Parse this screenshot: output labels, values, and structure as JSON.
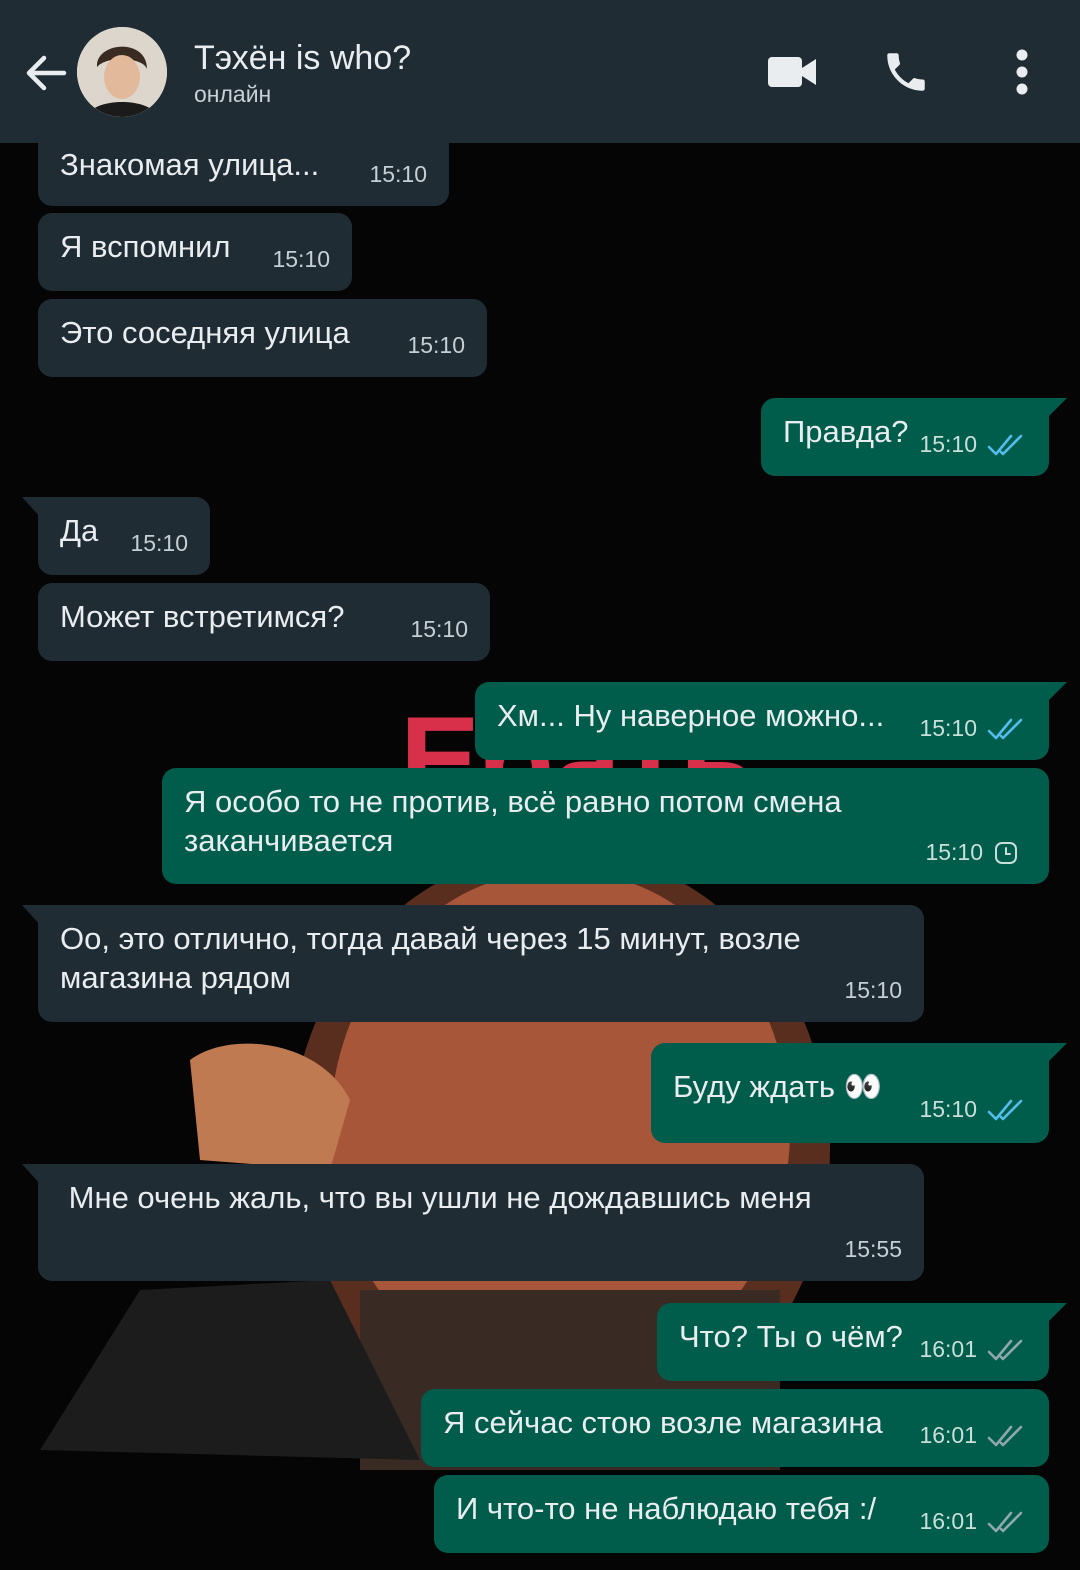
{
  "header": {
    "contact_name": "Тэхён is who?",
    "status": "онлайн",
    "back_icon": "arrow-left-icon",
    "video_icon": "video-call-icon",
    "call_icon": "phone-icon",
    "menu_icon": "more-vert-icon"
  },
  "colors": {
    "header_bg": "#1f2c34",
    "incoming_bg": "#1f2c34",
    "outgoing_bg": "#005c4b",
    "read_tick": "#53bdeb",
    "unread_tick": "#8fa7ae"
  },
  "wallpaper": {
    "caption": "Ебать"
  },
  "messages": [
    {
      "dir": "in",
      "text": "Знакомая улица...",
      "time": "15:10"
    },
    {
      "dir": "in",
      "text": "Я вспомнил",
      "time": "15:10"
    },
    {
      "dir": "in",
      "text": "Это соседняя улица",
      "time": "15:10"
    },
    {
      "dir": "out",
      "text": "Правда?",
      "time": "15:10",
      "status": "read"
    },
    {
      "dir": "in",
      "text": "Да",
      "time": "15:10"
    },
    {
      "dir": "in",
      "text": "Может встретимся?",
      "time": "15:10"
    },
    {
      "dir": "out",
      "text": "Хм... Ну наверное можно...",
      "time": "15:10",
      "status": "read"
    },
    {
      "dir": "out",
      "text": "Я особо то не против, всё равно потом смена заканчивается",
      "time": "15:10",
      "status": "pending"
    },
    {
      "dir": "in",
      "text": "Оо, это отлично, тогда давай через 15 минут, возле магазина рядом",
      "time": "15:10"
    },
    {
      "dir": "out",
      "text": "Буду ждать 👀",
      "time": "15:10",
      "status": "read"
    },
    {
      "dir": "in",
      "text": " Мне очень жаль, что вы ушли не дождавшись меня",
      "time": "15:55"
    },
    {
      "dir": "out",
      "text": "Что? Ты о чём?",
      "time": "16:01",
      "status": "delivered"
    },
    {
      "dir": "out",
      "text": "Я сейчас стою возле магазина",
      "time": "16:01",
      "status": "delivered"
    },
    {
      "dir": "out",
      "text": "И что-то не наблюдаю тебя :/",
      "time": "16:01",
      "status": "delivered"
    }
  ]
}
